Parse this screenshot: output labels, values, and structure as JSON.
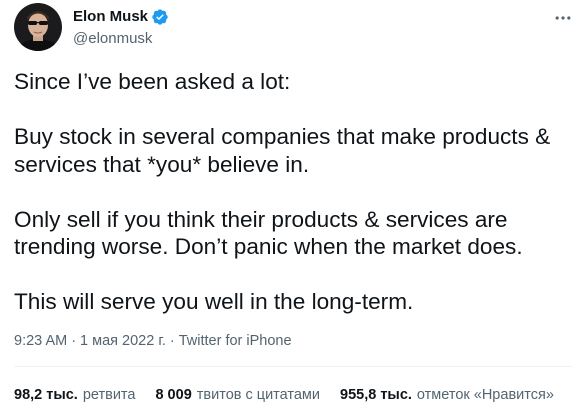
{
  "author": {
    "display_name": "Elon Musk",
    "handle": "@elonmusk",
    "verified": true
  },
  "icons": {
    "verified": "verified-badge-icon",
    "more": "more-options-icon"
  },
  "colors": {
    "verified_blue": "#1d9bf0",
    "secondary_text": "#536471",
    "primary_text": "#0f1419"
  },
  "tweet": {
    "paragraphs": [
      "Since I’ve been asked a lot:",
      "Buy stock in several companies that make products & services that *you* believe in.",
      "Only sell if you think their products & services are trending worse. Don’t panic when the market does.",
      "This will serve you well in the long-term."
    ]
  },
  "meta": {
    "time": "9:23 AM",
    "separator": "·",
    "date": "1 мая 2022 г.",
    "source": "Twitter for iPhone"
  },
  "stats": {
    "retweets_count": "98,2 тыс.",
    "retweets_label": "ретвита",
    "quotes_count": "8 009",
    "quotes_label": "твитов с цитатами",
    "likes_count": "955,8 тыс.",
    "likes_label": "отметок «Нравится»"
  }
}
